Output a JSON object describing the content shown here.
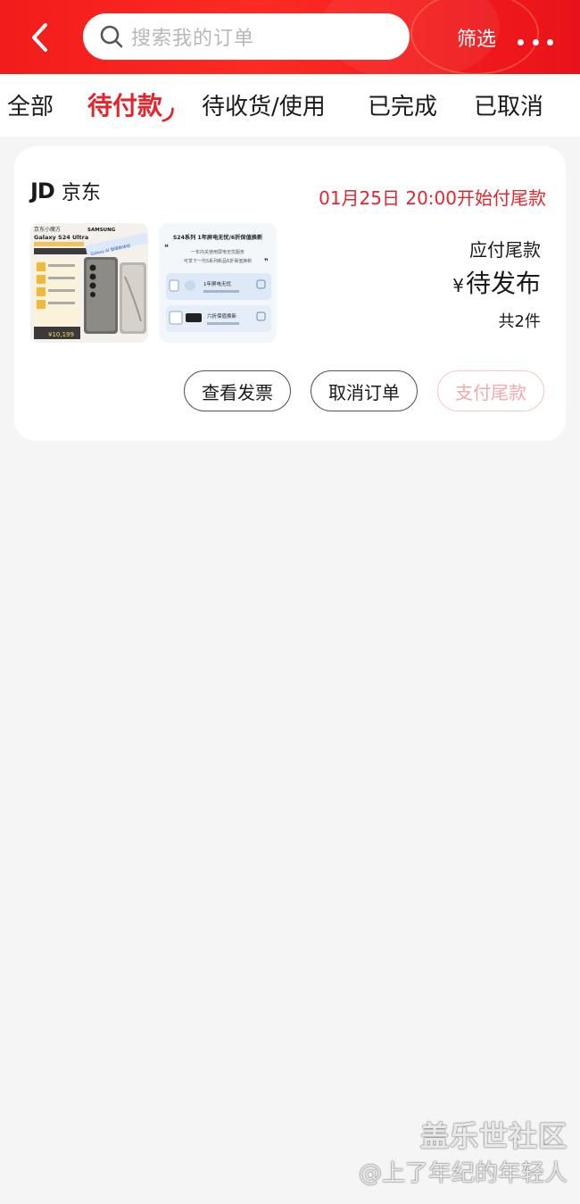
{
  "header": {
    "search_placeholder": "搜索我的订单",
    "filter_label": "筛选"
  },
  "tabs": [
    {
      "label": "全部"
    },
    {
      "label": "待付款",
      "active": true
    },
    {
      "label": "待收货/使用"
    },
    {
      "label": "已完成"
    },
    {
      "label": "已取消"
    }
  ],
  "order": {
    "shop_logo": "JD",
    "shop_name": "京东",
    "status": "01月25日 20:00开始付尾款",
    "price_label": "应付尾款",
    "currency": "¥",
    "price_value": "待发布",
    "item_count": "共2件",
    "products": [
      {
        "brand_left": "京东小魔方",
        "brand_right": "SAMSUNG",
        "model": "Galaxy S24 Ultra",
        "tagline": "Galaxy AI 智驱新体验",
        "price": "¥10,199"
      },
      {
        "headline": "S24系列 1年屏电无忧/6折保值换新",
        "sub1": "一年内关使用屏电无忧服务",
        "sub2": "可享下一代S系列新品6折保值换新",
        "feature1": "1年屏电无忧",
        "feature2": "六折保值换新"
      }
    ],
    "buttons": {
      "view_invoice": "查看发票",
      "cancel_order": "取消订单",
      "pay_balance": "支付尾款"
    }
  },
  "watermark": {
    "line1": "盖乐世社区",
    "line2": "@上了年纪的年轻人"
  },
  "colors": {
    "brand_red": "#e3262c",
    "header_red": "#f21c1c"
  }
}
